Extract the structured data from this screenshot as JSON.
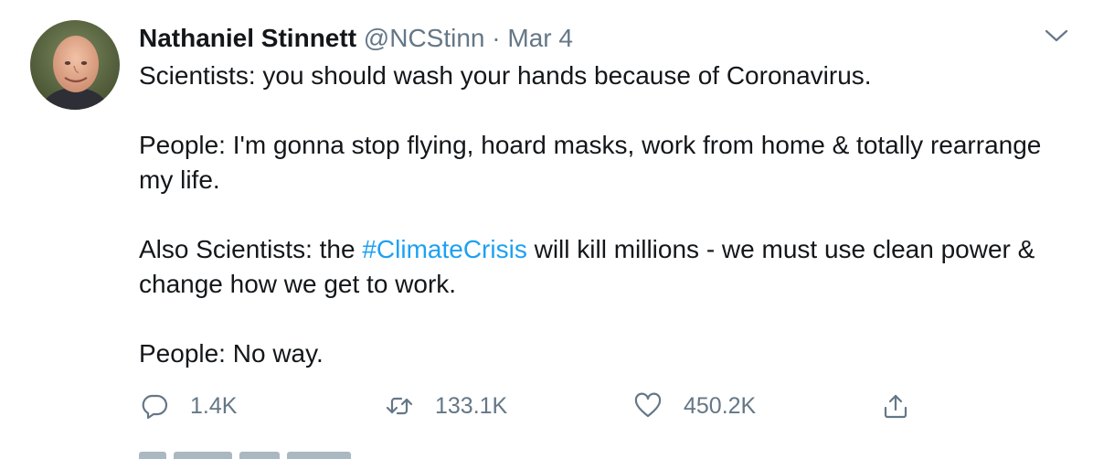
{
  "tweet": {
    "author_name": "Nathaniel Stinnett",
    "handle": "@NCStinn",
    "separator": "·",
    "date": "Mar 4",
    "paragraphs": {
      "p1": "Scientists: you should wash your hands because of Coronavirus.",
      "p2": "People: I'm gonna stop flying, hoard masks, work from home & totally rearrange my life.",
      "p3_before": "Also Scientists: the ",
      "p3_hashtag": "#ClimateCrisis",
      "p3_after": " will kill millions - we must use clean power & change how we get to work.",
      "p4": "People: No way."
    }
  },
  "actions": {
    "reply_count": "1.4K",
    "retweet_count": "133.1K",
    "like_count": "450.2K"
  },
  "icons": {
    "avatar": "author-avatar-photo",
    "caret": "chevron-down-icon",
    "reply": "reply-bubble-icon",
    "retweet": "retweet-arrows-icon",
    "like": "heart-icon",
    "share": "share-upload-icon"
  },
  "colors": {
    "text": "#14171a",
    "secondary": "#657786",
    "link": "#1da1f2",
    "background": "#ffffff"
  }
}
